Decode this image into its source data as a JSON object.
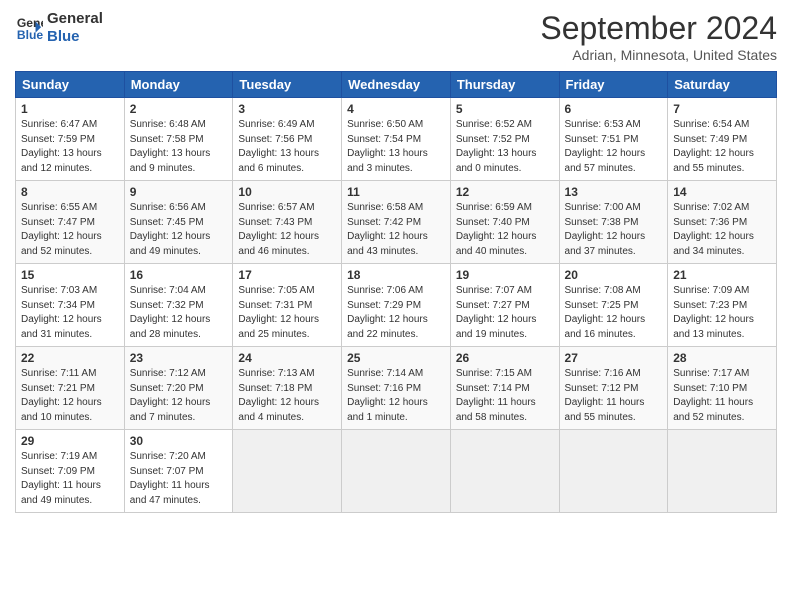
{
  "logo": {
    "line1": "General",
    "line2": "Blue"
  },
  "title": "September 2024",
  "location": "Adrian, Minnesota, United States",
  "days_of_week": [
    "Sunday",
    "Monday",
    "Tuesday",
    "Wednesday",
    "Thursday",
    "Friday",
    "Saturday"
  ],
  "weeks": [
    [
      {
        "day": "1",
        "info": "Sunrise: 6:47 AM\nSunset: 7:59 PM\nDaylight: 13 hours\nand 12 minutes."
      },
      {
        "day": "2",
        "info": "Sunrise: 6:48 AM\nSunset: 7:58 PM\nDaylight: 13 hours\nand 9 minutes."
      },
      {
        "day": "3",
        "info": "Sunrise: 6:49 AM\nSunset: 7:56 PM\nDaylight: 13 hours\nand 6 minutes."
      },
      {
        "day": "4",
        "info": "Sunrise: 6:50 AM\nSunset: 7:54 PM\nDaylight: 13 hours\nand 3 minutes."
      },
      {
        "day": "5",
        "info": "Sunrise: 6:52 AM\nSunset: 7:52 PM\nDaylight: 13 hours\nand 0 minutes."
      },
      {
        "day": "6",
        "info": "Sunrise: 6:53 AM\nSunset: 7:51 PM\nDaylight: 12 hours\nand 57 minutes."
      },
      {
        "day": "7",
        "info": "Sunrise: 6:54 AM\nSunset: 7:49 PM\nDaylight: 12 hours\nand 55 minutes."
      }
    ],
    [
      {
        "day": "8",
        "info": "Sunrise: 6:55 AM\nSunset: 7:47 PM\nDaylight: 12 hours\nand 52 minutes."
      },
      {
        "day": "9",
        "info": "Sunrise: 6:56 AM\nSunset: 7:45 PM\nDaylight: 12 hours\nand 49 minutes."
      },
      {
        "day": "10",
        "info": "Sunrise: 6:57 AM\nSunset: 7:43 PM\nDaylight: 12 hours\nand 46 minutes."
      },
      {
        "day": "11",
        "info": "Sunrise: 6:58 AM\nSunset: 7:42 PM\nDaylight: 12 hours\nand 43 minutes."
      },
      {
        "day": "12",
        "info": "Sunrise: 6:59 AM\nSunset: 7:40 PM\nDaylight: 12 hours\nand 40 minutes."
      },
      {
        "day": "13",
        "info": "Sunrise: 7:00 AM\nSunset: 7:38 PM\nDaylight: 12 hours\nand 37 minutes."
      },
      {
        "day": "14",
        "info": "Sunrise: 7:02 AM\nSunset: 7:36 PM\nDaylight: 12 hours\nand 34 minutes."
      }
    ],
    [
      {
        "day": "15",
        "info": "Sunrise: 7:03 AM\nSunset: 7:34 PM\nDaylight: 12 hours\nand 31 minutes."
      },
      {
        "day": "16",
        "info": "Sunrise: 7:04 AM\nSunset: 7:32 PM\nDaylight: 12 hours\nand 28 minutes."
      },
      {
        "day": "17",
        "info": "Sunrise: 7:05 AM\nSunset: 7:31 PM\nDaylight: 12 hours\nand 25 minutes."
      },
      {
        "day": "18",
        "info": "Sunrise: 7:06 AM\nSunset: 7:29 PM\nDaylight: 12 hours\nand 22 minutes."
      },
      {
        "day": "19",
        "info": "Sunrise: 7:07 AM\nSunset: 7:27 PM\nDaylight: 12 hours\nand 19 minutes."
      },
      {
        "day": "20",
        "info": "Sunrise: 7:08 AM\nSunset: 7:25 PM\nDaylight: 12 hours\nand 16 minutes."
      },
      {
        "day": "21",
        "info": "Sunrise: 7:09 AM\nSunset: 7:23 PM\nDaylight: 12 hours\nand 13 minutes."
      }
    ],
    [
      {
        "day": "22",
        "info": "Sunrise: 7:11 AM\nSunset: 7:21 PM\nDaylight: 12 hours\nand 10 minutes."
      },
      {
        "day": "23",
        "info": "Sunrise: 7:12 AM\nSunset: 7:20 PM\nDaylight: 12 hours\nand 7 minutes."
      },
      {
        "day": "24",
        "info": "Sunrise: 7:13 AM\nSunset: 7:18 PM\nDaylight: 12 hours\nand 4 minutes."
      },
      {
        "day": "25",
        "info": "Sunrise: 7:14 AM\nSunset: 7:16 PM\nDaylight: 12 hours\nand 1 minute."
      },
      {
        "day": "26",
        "info": "Sunrise: 7:15 AM\nSunset: 7:14 PM\nDaylight: 11 hours\nand 58 minutes."
      },
      {
        "day": "27",
        "info": "Sunrise: 7:16 AM\nSunset: 7:12 PM\nDaylight: 11 hours\nand 55 minutes."
      },
      {
        "day": "28",
        "info": "Sunrise: 7:17 AM\nSunset: 7:10 PM\nDaylight: 11 hours\nand 52 minutes."
      }
    ],
    [
      {
        "day": "29",
        "info": "Sunrise: 7:19 AM\nSunset: 7:09 PM\nDaylight: 11 hours\nand 49 minutes."
      },
      {
        "day": "30",
        "info": "Sunrise: 7:20 AM\nSunset: 7:07 PM\nDaylight: 11 hours\nand 47 minutes."
      },
      null,
      null,
      null,
      null,
      null
    ]
  ]
}
